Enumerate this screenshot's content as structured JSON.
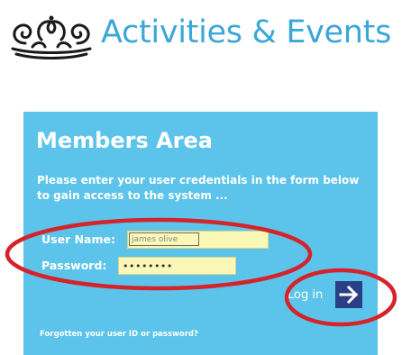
{
  "header": {
    "title": "Activities & Events"
  },
  "panel": {
    "title": "Members Area",
    "description": "Please enter your user credentials in the form below to gain access to the system ...",
    "username_label": "User Name:",
    "username_value": "james olive",
    "password_label": "Password:",
    "password_value": "••••••••",
    "login_label": "Log in",
    "forgot_link": "Forgotten your user ID or password?"
  },
  "icons": {
    "logo": "crown-crest-logo",
    "login": "arrow-right-icon"
  },
  "colors": {
    "title": "#3ba7d6",
    "panel_bg": "#5cc4ea",
    "input_bg": "#fbf7b6",
    "login_button": "#2a3f86",
    "annotation": "#d4232b"
  }
}
